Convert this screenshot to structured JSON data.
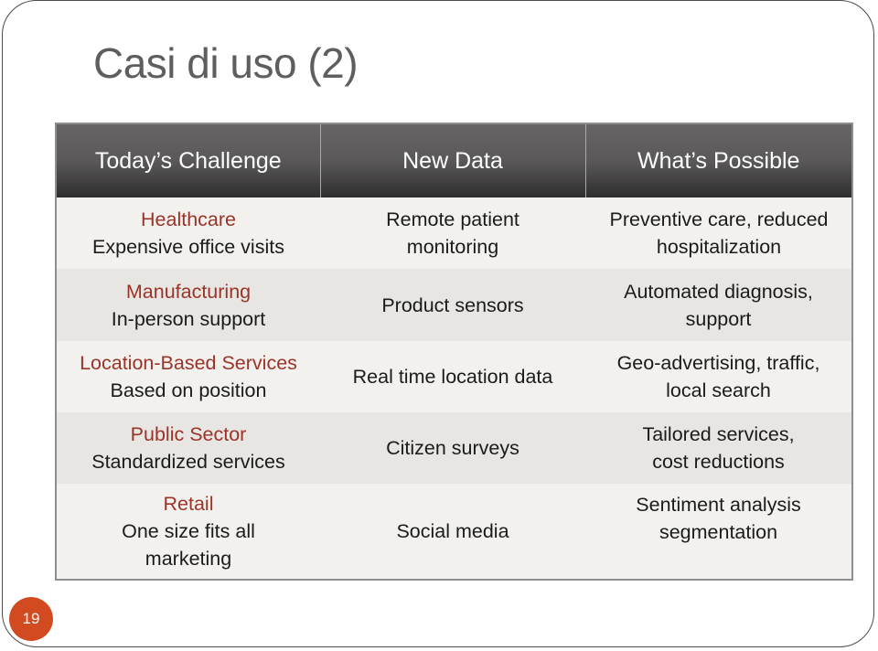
{
  "slide": {
    "title": "Casi di uso (2)",
    "page_number": "19",
    "accent_color": "#d24a1f",
    "sector_text_color": "#9b3328"
  },
  "table": {
    "headers": [
      "Today’s Challenge",
      "New Data",
      "What’s Possible"
    ],
    "rows": [
      {
        "sector": "Healthcare",
        "challenge": "Expensive office visits",
        "new_data": "Remote patient monitoring",
        "possible": "Preventive care, reduced hospitalization"
      },
      {
        "sector": "Manufacturing",
        "challenge": "In-person support",
        "new_data": "Product sensors",
        "possible": "Automated diagnosis, support"
      },
      {
        "sector": "Location-Based Services",
        "challenge": "Based on position",
        "new_data": "Real time location data",
        "possible": "Geo-advertising, traffic, local search"
      },
      {
        "sector": "Public Sector",
        "challenge": "Standardized services",
        "new_data": "Citizen surveys",
        "possible": "Tailored services, cost reductions"
      },
      {
        "sector": "Retail",
        "challenge": "One size fits all marketing",
        "new_data": "Social media",
        "possible": "Sentiment analysis segmentation"
      }
    ]
  }
}
